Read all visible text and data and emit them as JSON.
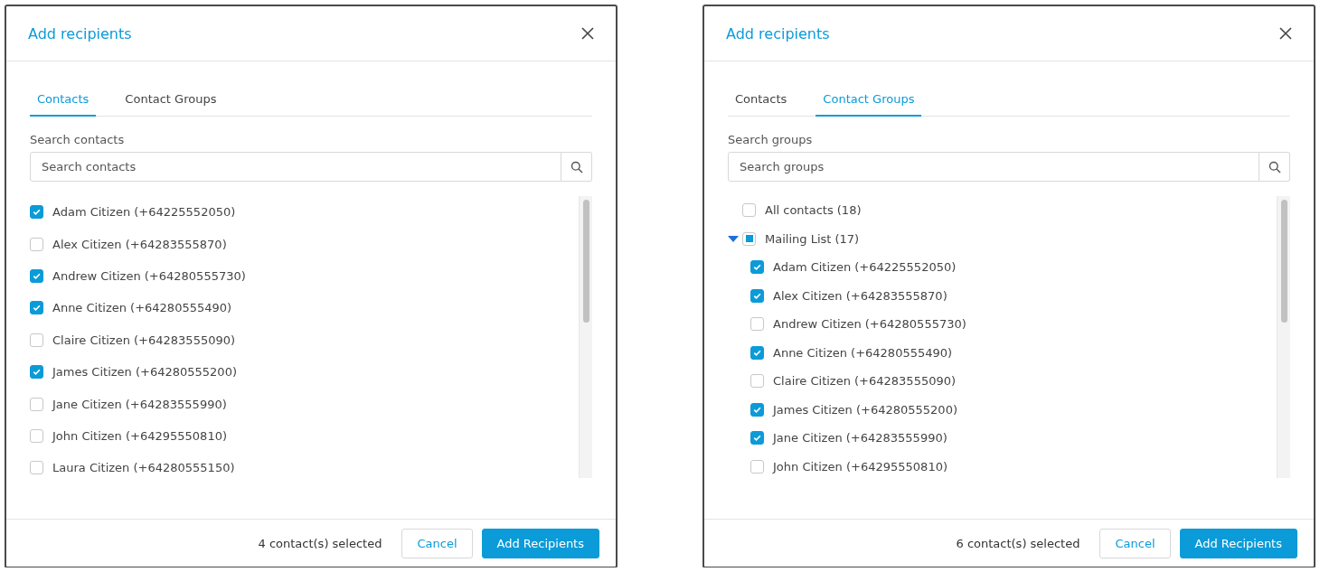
{
  "dialogs": [
    {
      "title": "Add recipients",
      "tabs": [
        {
          "label": "Contacts",
          "selected": true
        },
        {
          "label": "Contact Groups",
          "selected": false
        }
      ],
      "search": {
        "label": "Search contacts",
        "placeholder": "Search contacts"
      },
      "items": [
        {
          "label": "Adam Citizen (+64225552050)",
          "checked": true
        },
        {
          "label": "Alex Citizen (+64283555870)",
          "checked": false
        },
        {
          "label": "Andrew Citizen (+64280555730)",
          "checked": true
        },
        {
          "label": "Anne Citizen (+64280555490)",
          "checked": true
        },
        {
          "label": "Claire Citizen (+64283555090)",
          "checked": false
        },
        {
          "label": "James Citizen (+64280555200)",
          "checked": true
        },
        {
          "label": "Jane Citizen (+64283555990)",
          "checked": false
        },
        {
          "label": "John Citizen (+64295550810)",
          "checked": false
        },
        {
          "label": "Laura Citizen (+64280555150)",
          "checked": false
        }
      ],
      "footer": {
        "status": "4 contact(s) selected",
        "buttons": [
          {
            "label": "Cancel",
            "kind": "secondary"
          },
          {
            "label": "Add Recipients",
            "kind": "primary"
          }
        ]
      }
    },
    {
      "title": "Add recipients",
      "tabs": [
        {
          "label": "Contacts",
          "selected": false
        },
        {
          "label": "Contact Groups",
          "selected": true
        }
      ],
      "search": {
        "label": "Search groups",
        "placeholder": "Search groups"
      },
      "items": [
        {
          "label": "All contacts (18)",
          "checked": false,
          "indeterminate": false
        },
        {
          "label": "Mailing List (17)",
          "checked": false,
          "indeterminate": true,
          "expanded": true,
          "children": [
            {
              "label": "Adam Citizen (+64225552050)",
              "checked": true
            },
            {
              "label": "Alex Citizen (+64283555870)",
              "checked": true
            },
            {
              "label": "Andrew Citizen (+64280555730)",
              "checked": false
            },
            {
              "label": "Anne Citizen (+64280555490)",
              "checked": true
            },
            {
              "label": "Claire Citizen (+64283555090)",
              "checked": false
            },
            {
              "label": "James Citizen (+64280555200)",
              "checked": true
            },
            {
              "label": "Jane Citizen (+64283555990)",
              "checked": true
            },
            {
              "label": "John Citizen (+64295550810)",
              "checked": false
            }
          ]
        }
      ],
      "footer": {
        "status": "6 contact(s) selected",
        "buttons": [
          {
            "label": "Cancel",
            "kind": "secondary"
          },
          {
            "label": "Add Recipients",
            "kind": "primary"
          }
        ]
      }
    }
  ]
}
